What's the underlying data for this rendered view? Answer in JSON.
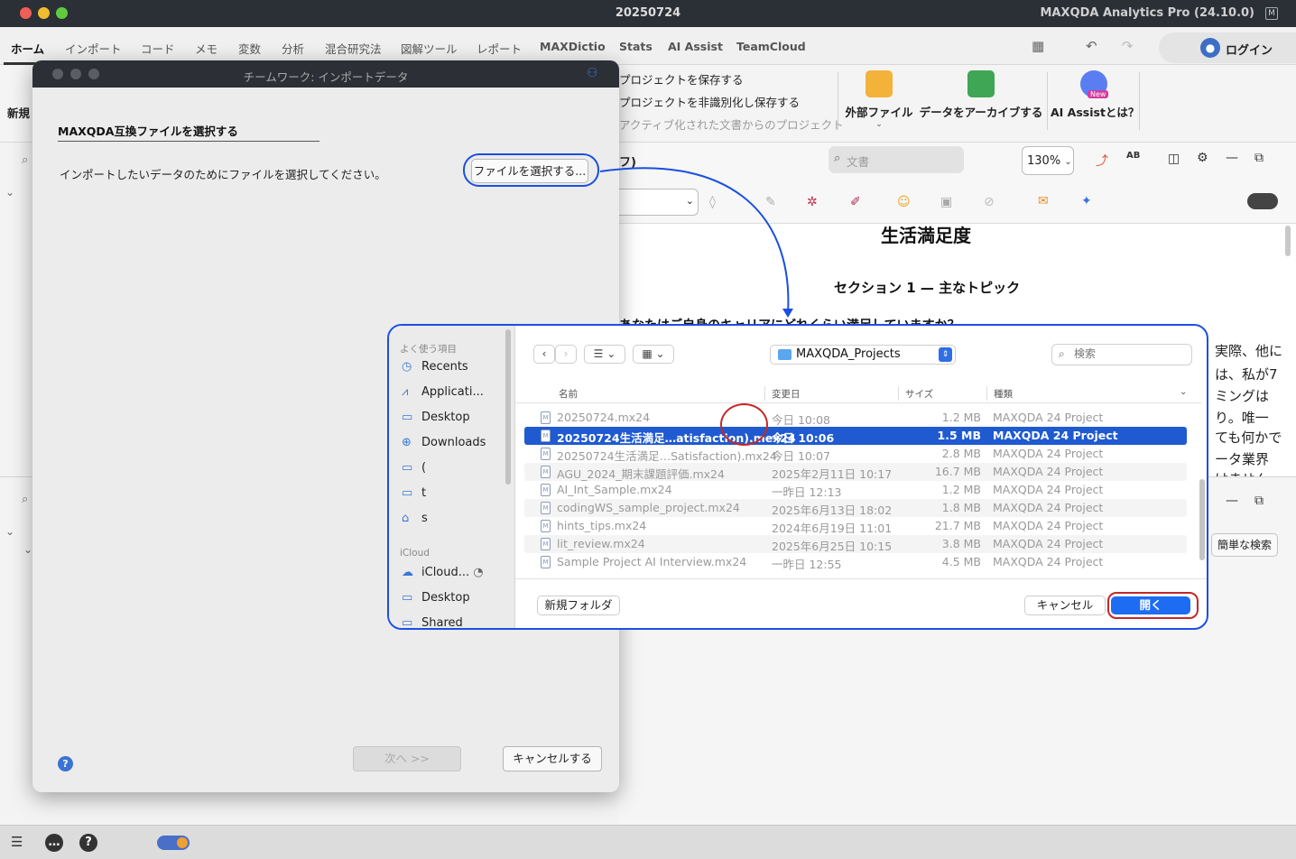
{
  "window": {
    "title": "20250724",
    "app_name": "MAXQDA Analytics Pro (24.10.0)",
    "app_icon": "maxqda-icon"
  },
  "menu": {
    "tabs": [
      "ホーム",
      "インポート",
      "コード",
      "メモ",
      "変数",
      "分析",
      "混合研究法",
      "図解ツール",
      "レポート",
      "MAXDictio",
      "Stats",
      "AI Assist",
      "TeamCloud"
    ],
    "active_tab": "ホーム",
    "login_label": "ログイン"
  },
  "ribbon": {
    "left_label": "新規",
    "project_actions": [
      "プロジェクトを保存する",
      "プロジェクトを非識別化し保存する",
      "アクティブ化された文書からのプロジェクト"
    ],
    "buttons": [
      "外部ファイル",
      "データをアーカイブする",
      "AI Assistとは？"
    ],
    "new_badge": "New"
  },
  "doc_toolbar": {
    "tab_fragment": "フ)",
    "search_placeholder": "文書",
    "zoom": "130%"
  },
  "document": {
    "title": "生活満足度",
    "section": "セクション 1 — 主なトピック",
    "question_partial": "あなたはご自身のキャリアにどれくらい満足していますか？",
    "right_fragments": [
      "実際、他に",
      "は、私が7",
      "ミングは",
      "り。唯一",
      "ても何かで",
      "ータ業界",
      "けません"
    ]
  },
  "lower_panel": {
    "simple_search": "簡単な検索"
  },
  "teamwork_dialog": {
    "title": "チームワーク: インポートデータ",
    "heading": "MAXQDA互換ファイルを選択する",
    "instruction": "インポートしたいデータのためにファイルを選択してください。",
    "choose_button": "ファイルを選択する...",
    "next_button": "次へ >>",
    "cancel_button": "キャンセルする",
    "help": "?"
  },
  "file_dialog": {
    "sidebar": {
      "favorites_label": "よく使う項目",
      "favorites": [
        {
          "label": "Recents",
          "icon": "clock-icon"
        },
        {
          "label": "Applicati...",
          "icon": "applications-icon"
        },
        {
          "label": "Desktop",
          "icon": "desktop-icon"
        },
        {
          "label": "Downloads",
          "icon": "downloads-icon"
        },
        {
          "label": "(",
          "icon": "folder-icon"
        },
        {
          "label": "t",
          "icon": "folder-icon"
        },
        {
          "label": "s",
          "icon": "home-icon"
        }
      ],
      "icloud_label": "iCloud",
      "icloud": [
        {
          "label": "iCloud...",
          "icon": "cloud-icon"
        },
        {
          "label": "Desktop",
          "icon": "desktop-icon"
        },
        {
          "label": "Shared",
          "icon": "shared-folder-icon"
        }
      ]
    },
    "location": "MAXQDA_Projects",
    "search_placeholder": "検索",
    "columns": [
      "名前",
      "変更日",
      "サイズ",
      "種類"
    ],
    "files": [
      {
        "name": "20250724.mx24",
        "date": "今日 10:08",
        "size": "1.2 MB",
        "kind": "MAXQDA 24 Project",
        "selected": false
      },
      {
        "name": "20250724生活満足…atisfaction).mex24",
        "date": "今日 10:06",
        "size": "1.5 MB",
        "kind": "MAXQDA 24 Project",
        "selected": true
      },
      {
        "name": "20250724生活満足…Satisfaction).mx24",
        "date": "今日 10:07",
        "size": "2.8 MB",
        "kind": "MAXQDA 24 Project",
        "selected": false
      },
      {
        "name": "AGU_2024_期末課題評価.mx24",
        "date": "2025年2月11日 10:17",
        "size": "16.7 MB",
        "kind": "MAXQDA 24 Project",
        "selected": false
      },
      {
        "name": "AI_Int_Sample.mx24",
        "date": "一昨日 12:13",
        "size": "1.2 MB",
        "kind": "MAXQDA 24 Project",
        "selected": false
      },
      {
        "name": "codingWS_sample_project.mx24",
        "date": "2025年6月13日 18:02",
        "size": "1.8 MB",
        "kind": "MAXQDA 24 Project",
        "selected": false
      },
      {
        "name": "hints_tips.mx24",
        "date": "2024年6月19日 11:01",
        "size": "21.7 MB",
        "kind": "MAXQDA 24 Project",
        "selected": false
      },
      {
        "name": "lit_review.mx24",
        "date": "2025年6月25日 10:15",
        "size": "3.8 MB",
        "kind": "MAXQDA 24 Project",
        "selected": false
      },
      {
        "name": "Sample Project AI Interview.mx24",
        "date": "一昨日 12:55",
        "size": "4.5 MB",
        "kind": "MAXQDA 24 Project",
        "selected": false
      }
    ],
    "new_folder_button": "新規フォルダ",
    "cancel_button": "キャンセル",
    "open_button": "開く"
  },
  "colors": {
    "accent": "#1e6cf2",
    "annotation_blue": "#1a4fe0",
    "annotation_red": "#c42828",
    "selection": "#1f5ad1",
    "titlebar": "#2b2f36"
  }
}
